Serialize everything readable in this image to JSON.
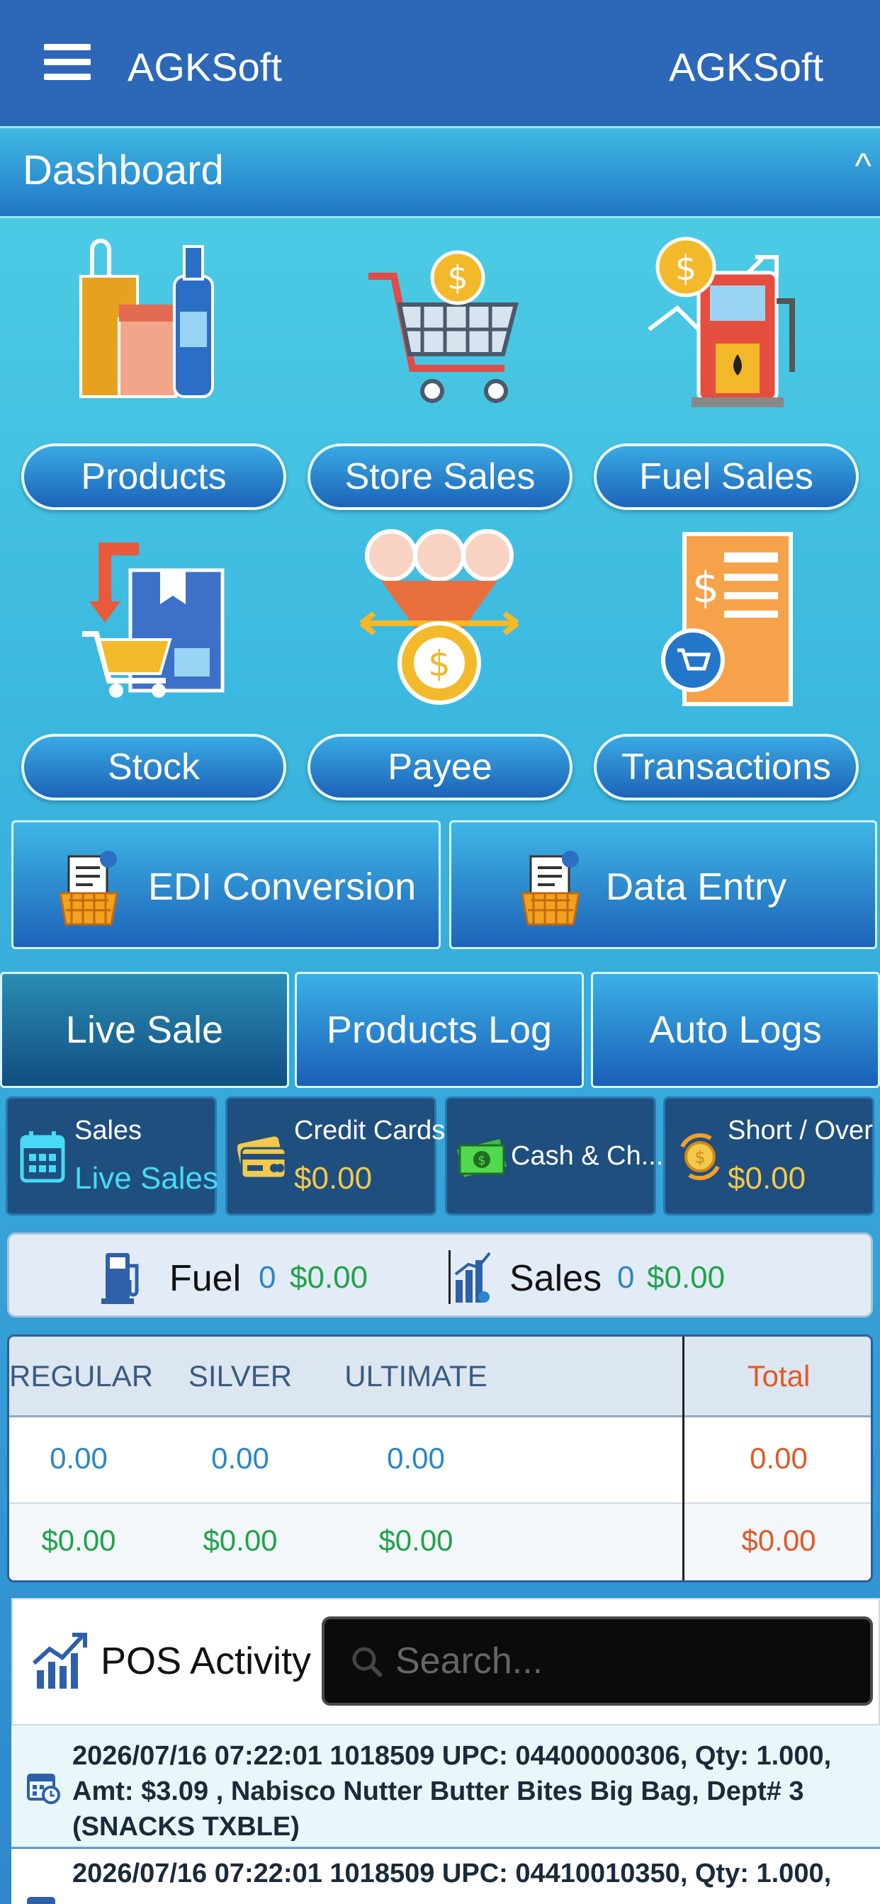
{
  "app": {
    "left_title": "AGKSoft",
    "right_title": "AGKSoft"
  },
  "dashboard": {
    "title": "Dashboard",
    "toggle": "^"
  },
  "tiles": [
    {
      "label": "Products",
      "icon": "products-icon"
    },
    {
      "label": "Store Sales",
      "icon": "store-sales-cart-icon"
    },
    {
      "label": "Fuel Sales",
      "icon": "fuel-pump-icon"
    },
    {
      "label": "Stock",
      "icon": "stock-box-icon"
    },
    {
      "label": "Payee",
      "icon": "payee-people-icon"
    },
    {
      "label": "Transactions",
      "icon": "transactions-receipt-icon"
    }
  ],
  "actions": [
    {
      "label": "EDI Conversion",
      "icon": "edi-basket-icon"
    },
    {
      "label": "Data Entry",
      "icon": "data-entry-basket-icon"
    }
  ],
  "tabs": [
    {
      "label": "Live Sale",
      "active": true
    },
    {
      "label": "Products Log",
      "active": false
    },
    {
      "label": "Auto Logs",
      "active": false
    }
  ],
  "cards": {
    "sales": {
      "title": "Sales",
      "value": "Live Sales"
    },
    "credit": {
      "title": "Credit Cards",
      "value": "$0.00"
    },
    "cash": {
      "title": "Cash & Ch..."
    },
    "short": {
      "title": "Short / Over",
      "value": "$0.00"
    }
  },
  "summary": {
    "fuel": {
      "label": "Fuel",
      "count": "0",
      "amount": "$0.00"
    },
    "sales": {
      "label": "Sales",
      "count": "0",
      "amount": "$0.00"
    }
  },
  "fuel_table": {
    "headers": [
      "REGULAR",
      "SILVER",
      "ULTIMATE"
    ],
    "total_header": "Total",
    "volumes": [
      "0.00",
      "0.00",
      "0.00"
    ],
    "total_volume": "0.00",
    "amounts": [
      "$0.00",
      "$0.00",
      "$0.00"
    ],
    "total_amount": "$0.00"
  },
  "pos": {
    "title": "POS Activity",
    "search_placeholder": "Search...",
    "entries": [
      "2026/07/16 07:22:01  1018509  UPC: 04400000306, Qty: 1.000, Amt: $3.09 , Nabisco Nutter Butter Bites Big Bag, Dept# 3 (SNACKS TXBLE)",
      "2026/07/16 07:22:01  1018509  UPC: 04410010350, Qty: 1.000,"
    ]
  },
  "colors": {
    "topbar": "#2d68b8",
    "accent_gold": "#f2c94c",
    "accent_cyan": "#47d9f5",
    "money_green": "#1fa34a",
    "total_orange": "#e05a25"
  }
}
